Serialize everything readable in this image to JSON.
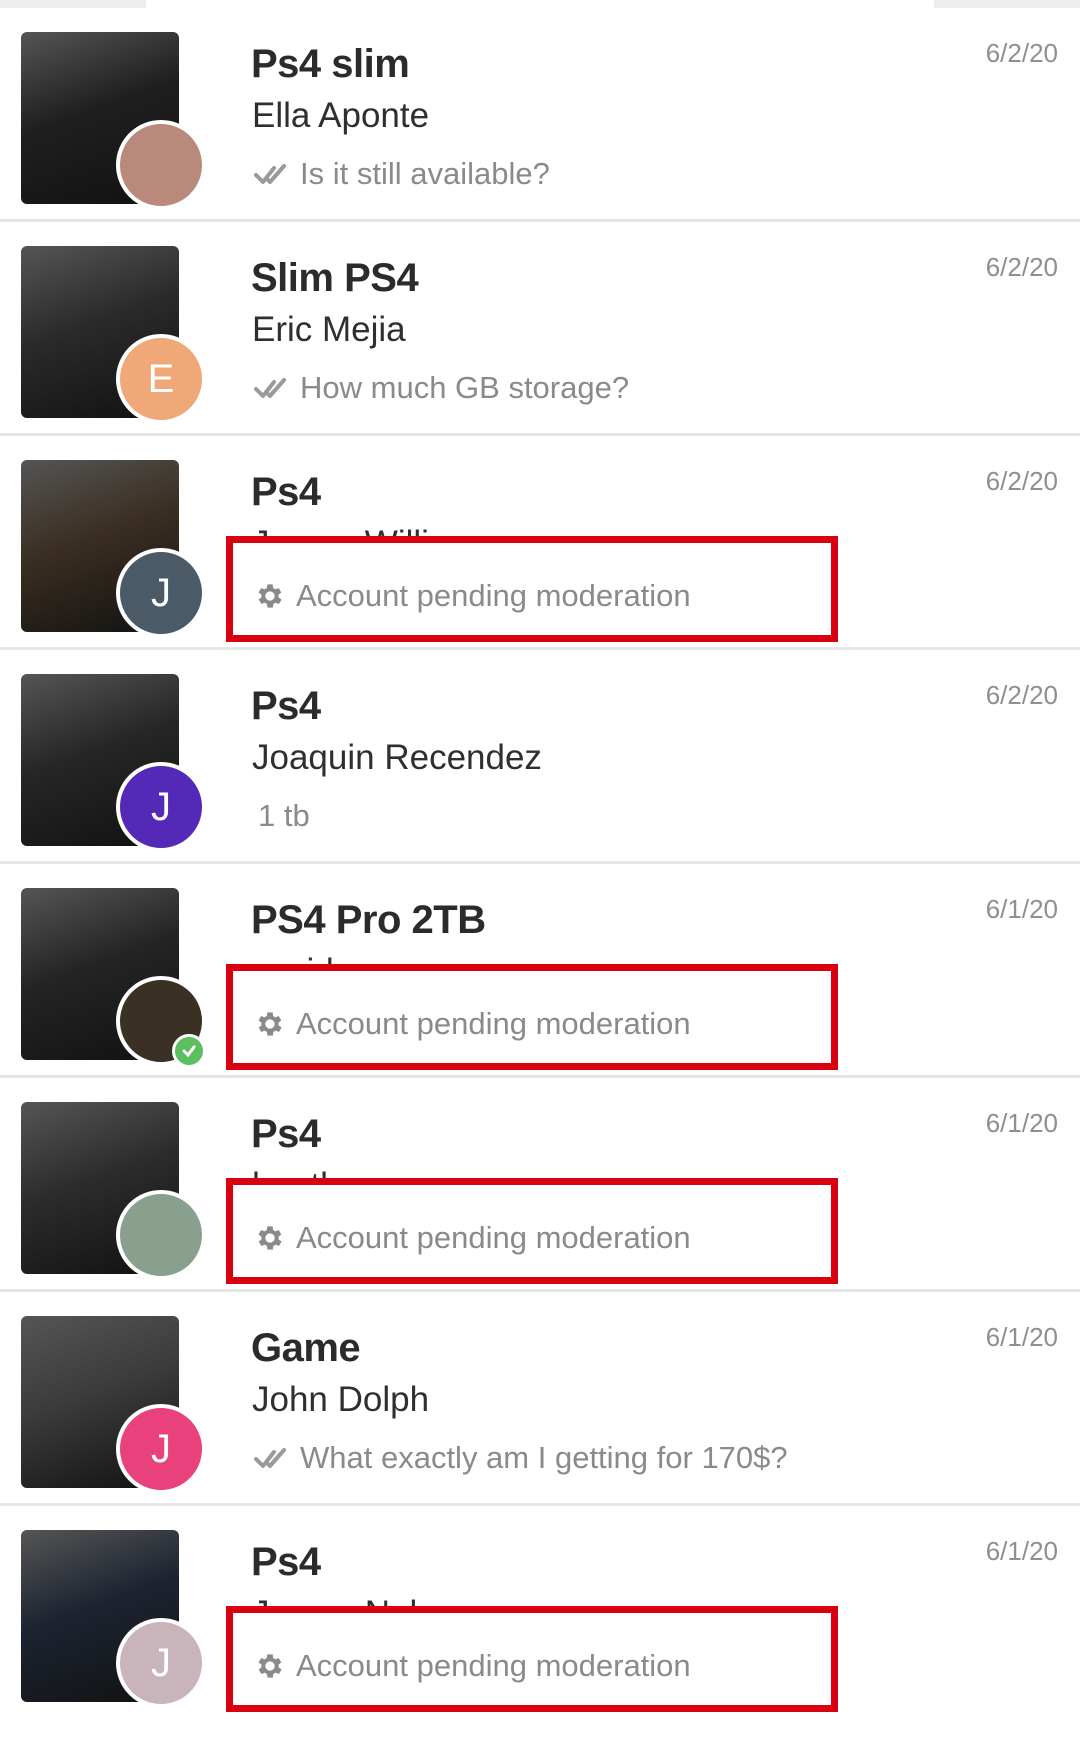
{
  "conversations": [
    {
      "title": "Ps4 slim",
      "name": "Ella Aponte",
      "message": "Is it still available?",
      "status": "read",
      "date": "6/2/20",
      "avatar_letter": "",
      "avatar_color": "#b98a7c",
      "thumb_color": "#1f1f1f"
    },
    {
      "title": "Slim PS4",
      "name": "Eric Mejia",
      "message": "How much GB storage?",
      "status": "read",
      "date": "6/2/20",
      "avatar_letter": "E",
      "avatar_color": "#f0a878",
      "thumb_color": "#2a2a2a"
    },
    {
      "title": "Ps4",
      "name": "James William",
      "message": "Account pending moderation",
      "status": "pending",
      "date": "6/2/20",
      "avatar_letter": "J",
      "avatar_color": "#4a5a66",
      "thumb_color": "#3a2e22"
    },
    {
      "title": "Ps4",
      "name": "Joaquin Recendez",
      "message": "1 tb",
      "status": "plain",
      "date": "6/2/20",
      "avatar_letter": "J",
      "avatar_color": "#5529b8",
      "thumb_color": "#262626"
    },
    {
      "title": "PS4 Pro 2TB",
      "name": "covid",
      "message": "Account pending moderation",
      "status": "pending",
      "date": "6/1/20",
      "avatar_letter": "",
      "avatar_color": "#3b3024",
      "thumb_color": "#242424"
    },
    {
      "title": "Ps4",
      "name": "heather",
      "message": "Account pending moderation",
      "status": "pending",
      "date": "6/1/20",
      "avatar_letter": "",
      "avatar_color": "#8aa08f",
      "thumb_color": "#2c2c2c"
    },
    {
      "title": "Game",
      "name": "John Dolph",
      "message": "What exactly am I getting for 170$?",
      "status": "read",
      "date": "6/1/20",
      "avatar_letter": "J",
      "avatar_color": "#e8417c",
      "thumb_color": "#3b3b3b"
    },
    {
      "title": "Ps4",
      "name": "James Nelson",
      "message": "Account pending moderation",
      "status": "pending",
      "date": "6/1/20",
      "avatar_letter": "J",
      "avatar_color": "#c8b4ba",
      "thumb_color": "#1c2330"
    }
  ],
  "colors": {
    "highlight": "#d9000f",
    "check": "#9a9a9a",
    "verified": "#5bbf60"
  }
}
